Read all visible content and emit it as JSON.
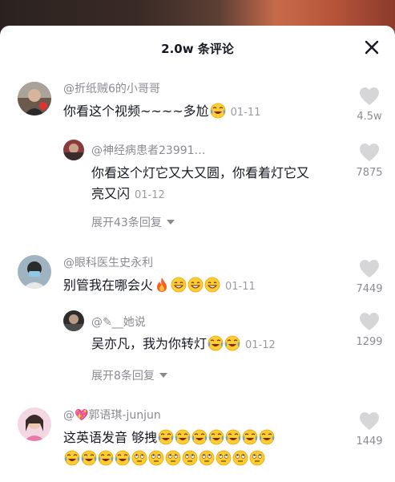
{
  "header": {
    "title": "2.0w 条评论"
  },
  "comments": [
    {
      "user": "@折纸贼6的小哥哥",
      "text": "你看这个视频~~~~多尬",
      "date": "01-11",
      "likes": "4.5w",
      "replies": [
        {
          "user": "@神经病患者23991…",
          "text_line1": "你看这个灯它又大又圆，你看着灯它又",
          "text_line2": "亮又闪",
          "date": "01-12",
          "likes": "7875"
        }
      ],
      "expand_label": "展开43条回复"
    },
    {
      "user": "@眼科医生史永利",
      "text": "别管我在哪会火",
      "date": "01-11",
      "likes": "7449",
      "replies": [
        {
          "user": "@✎__她说",
          "text": "吴亦凡，我为你转灯",
          "date": "01-12",
          "likes": "1299"
        }
      ],
      "expand_label": "展开8条回复"
    },
    {
      "user": "@💖郭语琪-junjun",
      "text": "这英语发音 够拽",
      "likes": "1449"
    }
  ],
  "icons": {
    "close": "close-icon",
    "like": "heart-icon",
    "fire": "fire-emoji",
    "laugh": "grin-emoji",
    "cry_laugh": "tears-of-joy-emoji",
    "roll_eyes": "eye-roll-emoji"
  },
  "colors": {
    "text": "#161823",
    "muted": "#8a8b91",
    "heart": "#d5d5d8"
  }
}
